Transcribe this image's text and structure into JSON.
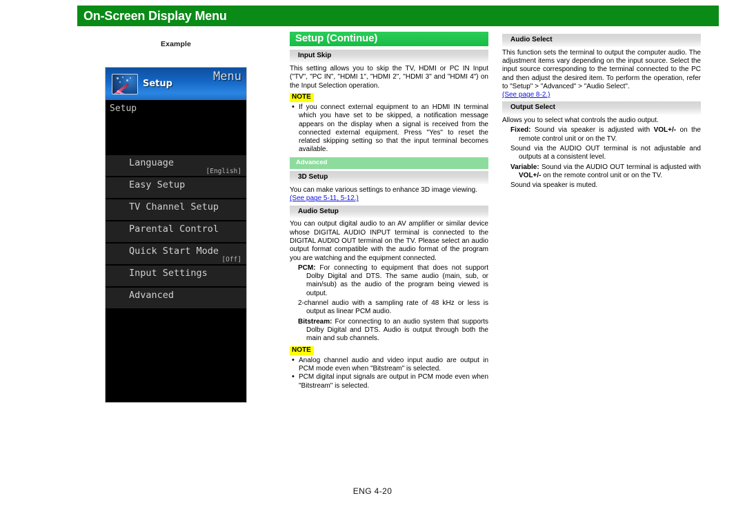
{
  "header": {
    "title": "On-Screen Display Menu",
    "bar_color": "#0a8a16"
  },
  "left": {
    "caption": "Example",
    "tv_menu": {
      "icon_name": "setup-monitor-icon",
      "header_label": "Setup",
      "menu_word": "Menu",
      "subtitle": "Setup",
      "rows": [
        {
          "label": "Language",
          "value": "[English]"
        },
        {
          "label": "Easy Setup",
          "value": ""
        },
        {
          "label": "TV Channel Setup",
          "value": ""
        },
        {
          "label": "Parental Control",
          "value": ""
        },
        {
          "label": "Quick Start Mode",
          "value": "[Off]"
        },
        {
          "label": "Input Settings",
          "value": ""
        },
        {
          "label": "Advanced",
          "value": ""
        }
      ]
    }
  },
  "middle": {
    "page_heading": "Setup (Continue)",
    "sections": [
      {
        "heading": "Input Skip",
        "body": "This setting allows you to skip the TV, HDMI or PC IN Input (\"TV\", \"PC IN\", \"HDMI 1\", \"HDMI 2\", \"HDMI 3\" and \"HDMI 4\") on the Input Selection operation.",
        "note_label": "NOTE",
        "note_items": [
          "If you connect external equipment to an HDMI IN terminal which you have set to be skipped, a notification message appears on the display when a signal is received from the connected external equipment. Press \"Yes\" to reset the related skipping setting so that the input terminal becomes available."
        ]
      }
    ],
    "advanced_bar": "Advanced",
    "setup_3d": {
      "heading": "3D Setup",
      "body": "You can make various settings to enhance 3D image viewing.",
      "link": "(See page 5-11, 5-12.)"
    },
    "audio_setup": {
      "heading": "Audio Setup",
      "body": "You can output digital audio to an AV amplifier or similar device whose DIGITAL AUDIO INPUT terminal is connected to the DIGITAL AUDIO OUT terminal on the TV. Please select an audio output format compatible with the audio format of the program you are watching and the equipment connected.",
      "defs": [
        {
          "term": "PCM:",
          "text": " For connecting to equipment that does not support Dolby Digital and DTS. The same audio (main, sub, or main/sub) as the audio of the program being viewed is output."
        },
        {
          "term": "",
          "text": "2-channel audio with a sampling rate of 48 kHz or less is output as linear PCM audio."
        },
        {
          "term": "Bitstream:",
          "text": " For connecting to an audio system that supports Dolby Digital and DTS. Audio is output through both the main and sub channels."
        }
      ],
      "note_label": "NOTE",
      "note_items": [
        "Analog channel audio and video input audio are output in PCM mode even when \"Bitstream\" is selected.",
        "PCM digital input signals are output in PCM mode even when \"Bitstream\" is selected."
      ]
    }
  },
  "right": {
    "audio_select": {
      "heading": "Audio Select",
      "body": "This function sets the terminal to output the computer audio. The adjustment items vary depending on the input source. Select the input source corresponding to the terminal connected to the PC and then adjust the desired item. To perform the operation, refer to \"Setup\" > \"Advanced\" > \"Audio Select\".",
      "link": "(See page 8-2.)"
    },
    "output_select": {
      "heading": "Output Select",
      "body": "Allows you to select what controls the audio output.",
      "defs": [
        {
          "term": "Fixed:",
          "pre": " Sound via speaker is adjusted with ",
          "bold": "VOL+/-",
          "post": " on the remote control unit or on the TV."
        },
        {
          "term": "",
          "pre": "Sound via the AUDIO OUT terminal is not adjustable and outputs at a consistent level.",
          "bold": "",
          "post": ""
        },
        {
          "term": "Variable:",
          "pre": " Sound via the AUDIO OUT terminal is adjusted with ",
          "bold": "VOL+/-",
          "post": " on the remote control unit or on the TV."
        },
        {
          "term": "",
          "pre": "Sound via speaker is muted.",
          "bold": "",
          "post": ""
        }
      ]
    }
  },
  "footer": {
    "text": "ENG 4-20"
  }
}
